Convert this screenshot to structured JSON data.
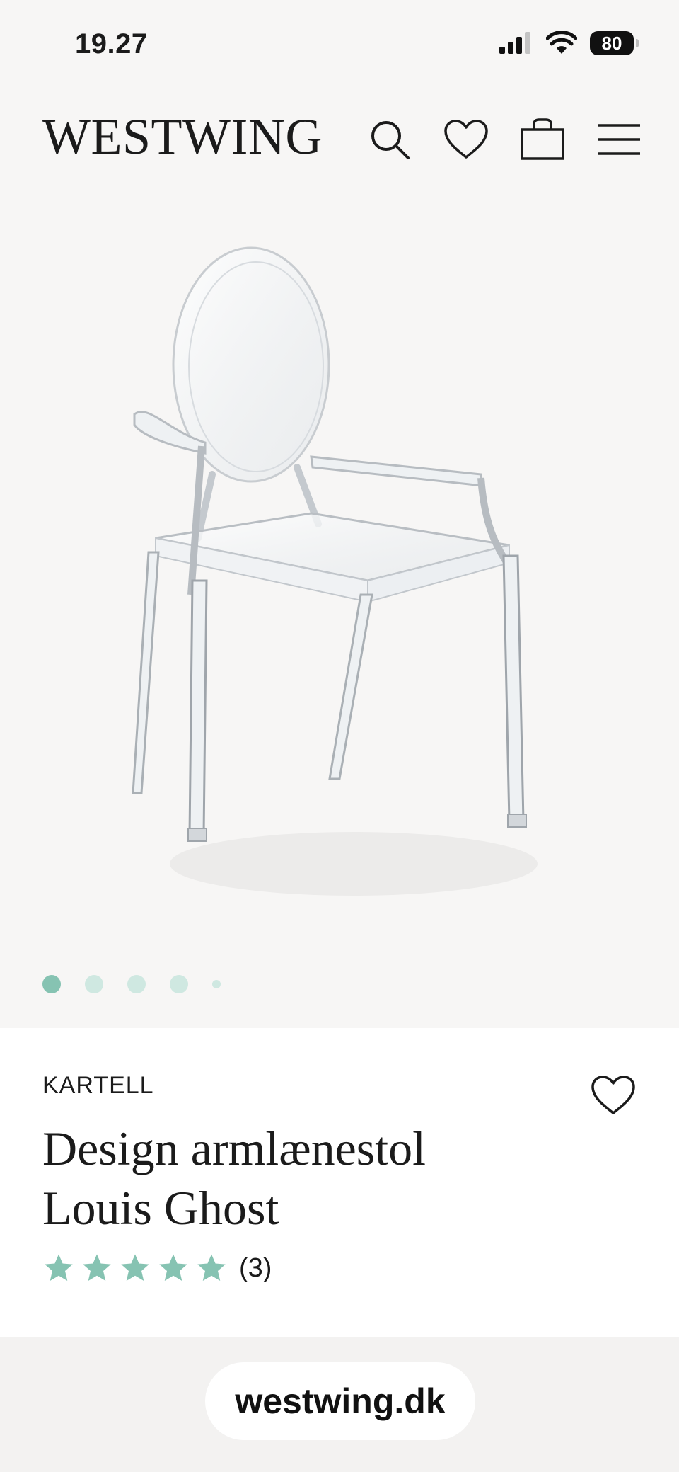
{
  "status_bar": {
    "time": "19.27",
    "battery": "80",
    "icons": [
      "cellular-signal-icon",
      "wifi-icon",
      "battery-icon"
    ]
  },
  "header": {
    "logo": "WESTWING",
    "icons": [
      "search-icon",
      "heart-icon",
      "shopping-bag-icon",
      "menu-icon"
    ]
  },
  "gallery": {
    "image": "transparent-chair-icon",
    "slide_count": 5,
    "active_slide": 1
  },
  "product": {
    "brand": "KARTELL",
    "title_line1": "Design armlænestol",
    "title_line2": "Louis Ghost",
    "rating_stars": 5,
    "rating_count": "(3)",
    "colors": {
      "star": "#86c3b2",
      "dot_active": "#86c3b2",
      "dot_inactive": "#cfe8e1"
    }
  },
  "browser": {
    "url": "westwing.dk"
  }
}
